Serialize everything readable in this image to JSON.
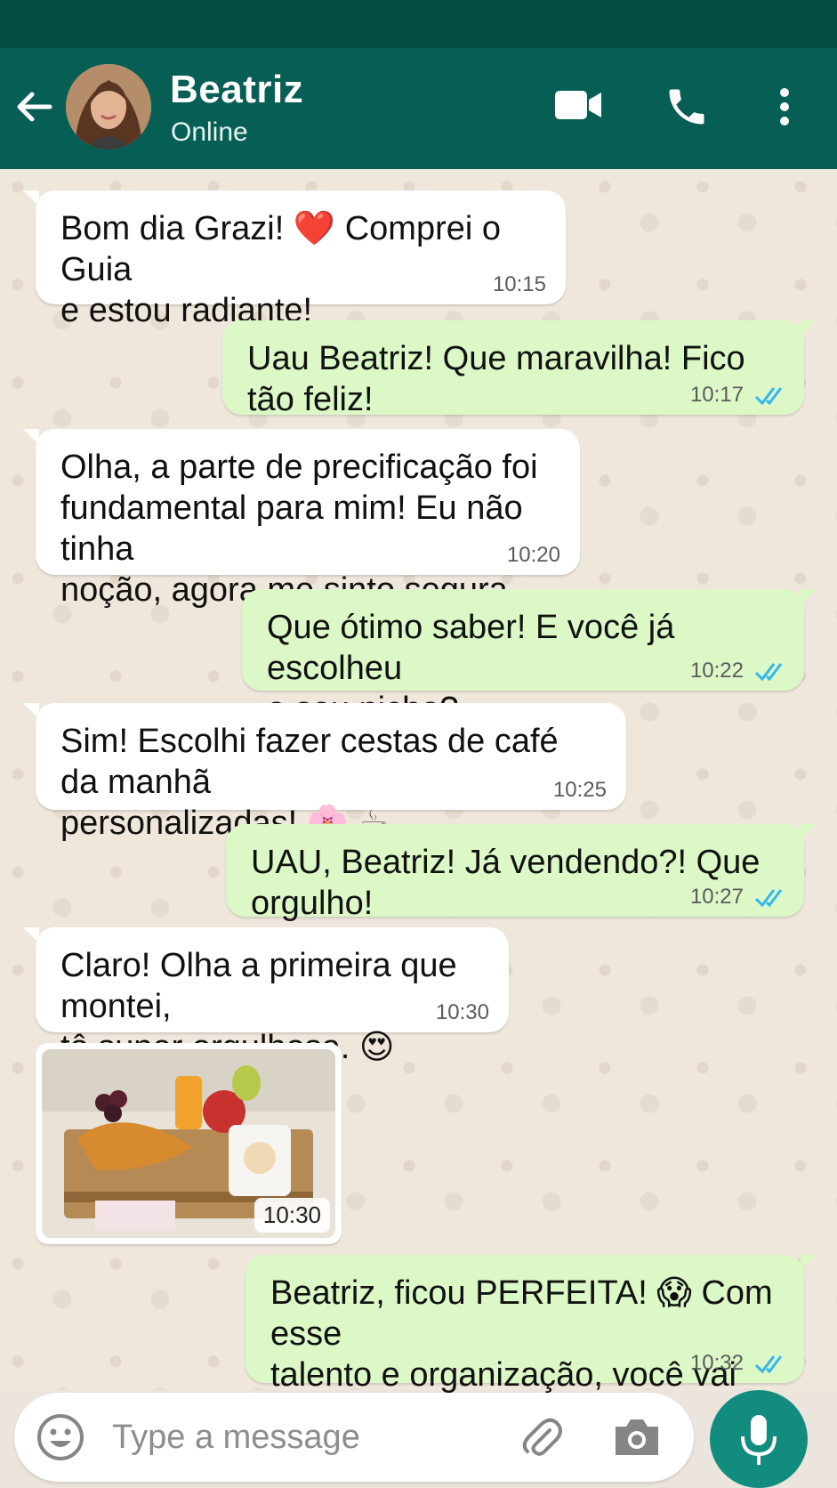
{
  "contact": {
    "name": "Beatriz",
    "status": "Online"
  },
  "colors": {
    "header": "#075e54",
    "status_bar": "#054d44",
    "outgoing_bubble": "#dcf8c6",
    "incoming_bubble": "#ffffff",
    "read_ticks": "#34b7f1",
    "mic_button": "#128c7e"
  },
  "header_icons": [
    "back-arrow-icon",
    "video-call-icon",
    "phone-call-icon",
    "more-options-icon"
  ],
  "messages": [
    {
      "direction": "incoming",
      "text": "Bom dia Grazi! ❤️ Comprei o Guia\ne estou radiante!",
      "time": "10:15"
    },
    {
      "direction": "outgoing",
      "text": "Uau Beatriz! Que maravilha! Fico tão feliz!",
      "time": "10:17",
      "status": "read"
    },
    {
      "direction": "incoming",
      "text": "Olha, a parte de precificação foi\nfundamental para mim! Eu não tinha\nnoção, agora me sinto segura.",
      "time": "10:20"
    },
    {
      "direction": "outgoing",
      "text": "Que ótimo saber! E você já escolheu\no seu nicho?",
      "time": "10:22",
      "status": "read"
    },
    {
      "direction": "incoming",
      "text": "Sim! Escolhi fazer cestas de café da manhã\npersonalizadas! 🌸 ☕",
      "time": "10:25"
    },
    {
      "direction": "outgoing",
      "text": "UAU, Beatriz! Já vendendo?! Que orgulho!",
      "time": "10:27",
      "status": "read"
    },
    {
      "direction": "incoming",
      "text": "Claro! Olha a primeira que montei,\ntô super orgulhosa. 😍",
      "time": "10:30"
    },
    {
      "direction": "incoming",
      "type": "image",
      "caption_time": "10:30",
      "image_description": "breakfast-basket-photo"
    },
    {
      "direction": "outgoing",
      "text": "Beatriz, ficou PERFEITA! 😱 Com esse\ntalento e organização, você vai longe!\nParabéns!",
      "time": "10:32",
      "status": "read"
    }
  ],
  "input": {
    "placeholder": "Type a message",
    "value": ""
  },
  "input_icons": [
    "emoji-icon",
    "attach-icon",
    "camera-icon",
    "mic-icon"
  ]
}
